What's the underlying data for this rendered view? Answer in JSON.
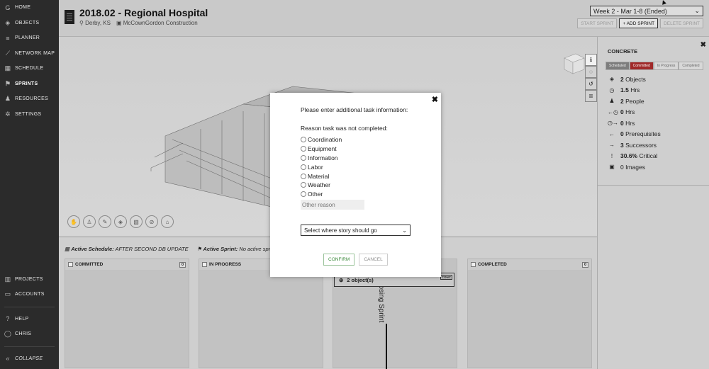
{
  "sidebar": {
    "top": [
      {
        "label": "HOME",
        "icon": "home-icon",
        "glyph": "G"
      },
      {
        "label": "OBJECTS",
        "icon": "cube-icon",
        "glyph": "◈"
      },
      {
        "label": "PLANNER",
        "icon": "list-icon",
        "glyph": "≡"
      },
      {
        "label": "NETWORK MAP",
        "icon": "network-icon",
        "glyph": "⟋"
      },
      {
        "label": "SCHEDULE",
        "icon": "calendar-icon",
        "glyph": "▦"
      },
      {
        "label": "SPRINTS",
        "icon": "flag-icon",
        "glyph": "⚑"
      },
      {
        "label": "RESOURCES",
        "icon": "person-icon",
        "glyph": "♟"
      },
      {
        "label": "SETTINGS",
        "icon": "gear-icon",
        "glyph": "✲"
      }
    ],
    "bottom": [
      {
        "label": "PROJECTS",
        "icon": "building-icon",
        "glyph": "▥"
      },
      {
        "label": "ACCOUNTS",
        "icon": "card-icon",
        "glyph": "▭"
      },
      {
        "label": "HELP",
        "icon": "help-icon",
        "glyph": "?"
      },
      {
        "label": "CHRIS",
        "icon": "user-icon",
        "glyph": "◯"
      },
      {
        "label": "COLLAPSE",
        "icon": "collapse-icon",
        "glyph": "«"
      }
    ]
  },
  "header": {
    "title": "2018.02 - Regional Hospital",
    "location": "Derby, KS",
    "company": "McCownGordon Construction",
    "week_select": "Week 2 - Mar 1-8  (Ended)",
    "start_sprint": "START SPRINT",
    "add_sprint": "+ ADD SPRINT",
    "delete_sprint": "DELETE SPRINT"
  },
  "board": {
    "active_schedule_label": "Active Schedule:",
    "active_schedule_value": "AFTER SECOND DB UPDATE",
    "active_sprint_label": "Active Sprint:",
    "active_sprint_value": "No active sprint",
    "columns": [
      {
        "label": "COMMITTED",
        "count": "0"
      },
      {
        "label": "IN PROGRESS",
        "count": "0"
      },
      {
        "label": "COMPLETED",
        "count": "0"
      }
    ],
    "card_text": "2 object(s)",
    "card_tag": "CONC",
    "closing_label": "Closing Sprint"
  },
  "panel": {
    "title": "CONCRETE",
    "tabs": [
      "Scheduled",
      "Committed",
      "In Progress",
      "Completed"
    ],
    "stats": [
      {
        "icon": "cube-icon",
        "glyph": "◈",
        "bold": "2",
        "text": "Objects"
      },
      {
        "icon": "clock-icon",
        "glyph": "◷",
        "bold": "1.5",
        "text": "Hrs"
      },
      {
        "icon": "person-icon",
        "glyph": "♟",
        "bold": "2",
        "text": "People"
      },
      {
        "icon": "before-clock-icon",
        "glyph": "←◷",
        "bold": "0",
        "text": "Hrs"
      },
      {
        "icon": "after-clock-icon",
        "glyph": "◷→",
        "bold": "0",
        "text": "Hrs"
      },
      {
        "icon": "arrow-left-icon",
        "glyph": "←",
        "bold": "0",
        "text": "Prerequisites"
      },
      {
        "icon": "arrow-right-icon",
        "glyph": "→",
        "bold": "3",
        "text": "Successors"
      },
      {
        "icon": "exclamation-icon",
        "glyph": "!",
        "bold": "30.6%",
        "text": "Critical"
      },
      {
        "icon": "image-icon",
        "glyph": "▣",
        "bold": "",
        "text": "0 Images"
      }
    ]
  },
  "modal": {
    "message": "Please enter additional task information:",
    "question": "Reason task was not completed:",
    "reasons": [
      "Coordination",
      "Equipment",
      "Information",
      "Labor",
      "Material",
      "Weather",
      "Other"
    ],
    "other_placeholder": "Other reason",
    "story_select": "Select where story should go",
    "confirm": "CONFIRM",
    "cancel": "CANCEL"
  },
  "colors": {
    "sidebar_bg": "#2b2b2b",
    "committed_tab": "#a02929",
    "confirm_text": "#3a8a3a"
  }
}
